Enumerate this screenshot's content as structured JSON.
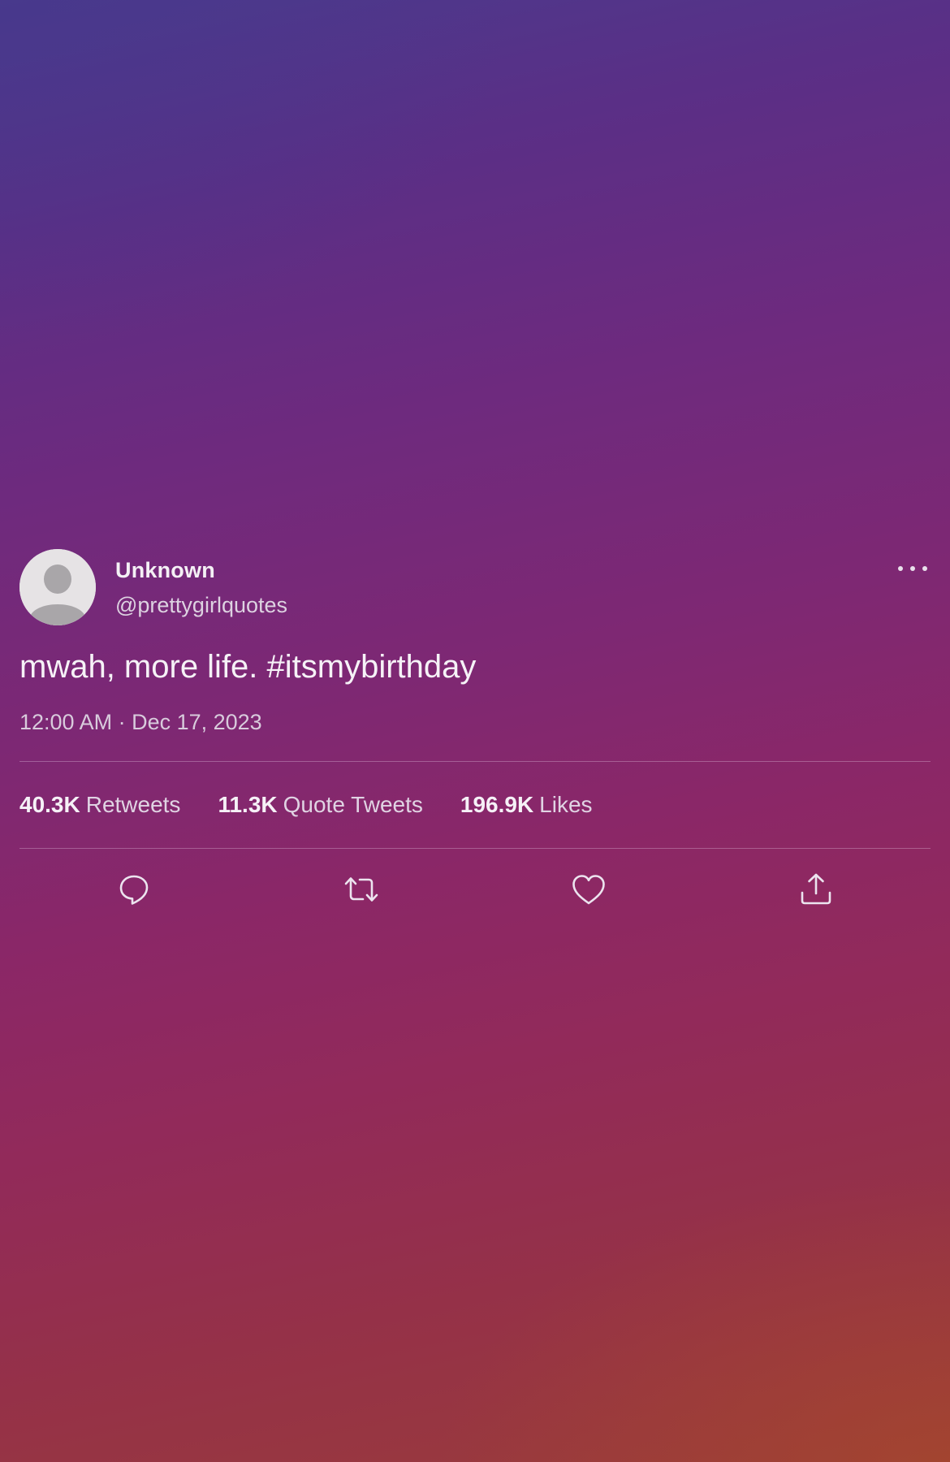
{
  "tweet": {
    "user": {
      "name": "Unknown",
      "handle": "@prettygirlquotes",
      "avatar_icon": "default-avatar-icon"
    },
    "text": "mwah, more life. #itsmybirthday",
    "timestamp": "12:00 AM · Dec 17, 2023",
    "stats": {
      "retweets": {
        "count": "40.3K",
        "label": "Retweets"
      },
      "quote_tweets": {
        "count": "11.3K",
        "label": "Quote Tweets"
      },
      "likes": {
        "count": "196.9K",
        "label": "Likes"
      }
    },
    "actions": [
      "reply-icon",
      "retweet-icon",
      "like-icon",
      "share-icon"
    ],
    "more_icon": "more-options-icon"
  },
  "colors": {
    "background_top": "#4a3b8d",
    "background_mid": "#8b2767",
    "background_bottom": "#9a3c3a",
    "text_primary": "#f6f2f7",
    "text_secondary": "#d8cbdc"
  }
}
